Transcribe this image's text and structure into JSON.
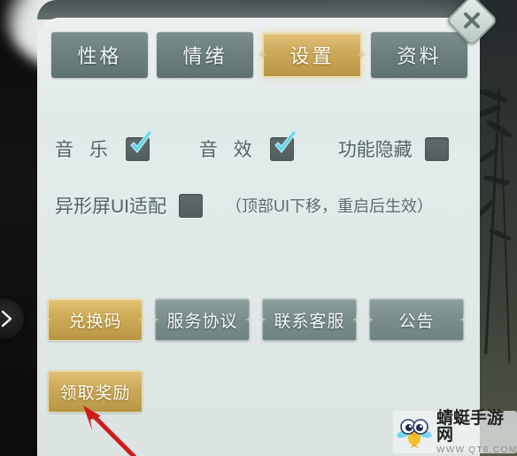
{
  "window": {
    "title": "设置",
    "close_label": "✕",
    "close_icon": "close-icon"
  },
  "edge_nav": {
    "label": "›",
    "icon": "chevron-right-icon"
  },
  "tabs": [
    {
      "label": "性格",
      "active": false
    },
    {
      "label": "情绪",
      "active": false
    },
    {
      "label": "设置",
      "active": true
    },
    {
      "label": "资料",
      "active": false
    }
  ],
  "options": {
    "row1": [
      {
        "label": "音 乐",
        "checked": true,
        "icon": "checkbox-checked-icon"
      },
      {
        "label": "音 效",
        "checked": true,
        "icon": "checkbox-checked-icon"
      },
      {
        "label": "功能隐藏",
        "checked": false,
        "icon": "checkbox-unchecked-icon"
      }
    ],
    "row2": {
      "label": "异形屏UI适配",
      "checked": false,
      "icon": "checkbox-unchecked-icon",
      "note": "（顶部UI下移，重启后生效）"
    }
  },
  "buttons": [
    {
      "label": "兑换码",
      "style": "gold"
    },
    {
      "label": "服务协议",
      "style": "grey"
    },
    {
      "label": "联系客服",
      "style": "grey"
    },
    {
      "label": "公告",
      "style": "grey"
    }
  ],
  "reward_button": {
    "label": "领取奖励",
    "style": "gold"
  },
  "annotation": {
    "type": "arrow",
    "color": "#cc1b1b",
    "points_to": "领取奖励",
    "icon": "red-arrow-icon"
  },
  "watermark": {
    "name": "蜻蜓手游网",
    "url": "WWW.QT6.COM",
    "icon": "dragonfly-mascot-icon"
  },
  "colors": {
    "panel_bg": "#e0e8e8",
    "tab_active": "#cfab5d",
    "tab_inactive": "#6d807e",
    "gold_button": "#cdaa5a",
    "grey_button": "#7b8e8c",
    "checkbox_box": "#566362",
    "checkbox_tick": "#5fd6e8",
    "label_text": "#4f6366",
    "annotation_red": "#cc1b1b"
  }
}
